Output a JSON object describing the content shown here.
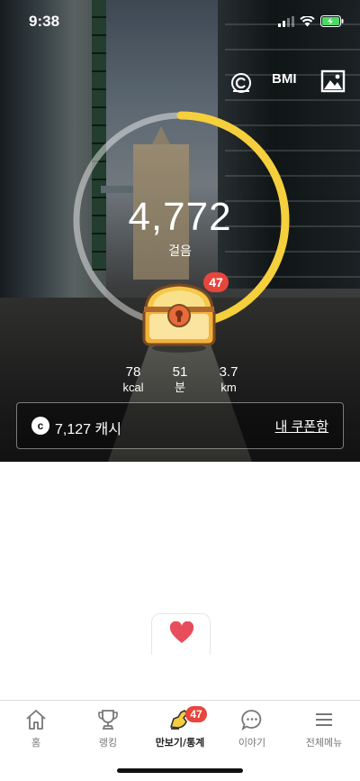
{
  "status_bar": {
    "time": "9:38",
    "battery_color": "#4cd964"
  },
  "top_actions": {
    "coin_icon": "coin-c-icon",
    "bmi_label": "BMI",
    "image_icon": "image-icon"
  },
  "pedometer": {
    "steps": "4,772",
    "steps_unit": "걸음",
    "goal_progress": 0.5,
    "ring_color": "#f5cf3c",
    "chest_badge": "47",
    "stats": [
      {
        "value": "78",
        "unit": "kcal"
      },
      {
        "value": "51",
        "unit": "분"
      },
      {
        "value": "3.7",
        "unit": "km"
      }
    ]
  },
  "cash": {
    "icon_letter": "c",
    "amount": "7,127 캐시",
    "coupon_link": "내 쿠폰함"
  },
  "heart": {
    "icon": "heart-icon",
    "color": "#e84d5b"
  },
  "tab_bar": {
    "tabs": [
      {
        "label": "홈",
        "icon": "home-icon"
      },
      {
        "label": "랭킹",
        "icon": "trophy-icon"
      },
      {
        "label": "만보기/통계",
        "icon": "shoe-icon",
        "badge": "47",
        "active": true
      },
      {
        "label": "이야기",
        "icon": "chat-bubble-icon"
      },
      {
        "label": "전체메뉴",
        "icon": "hamburger-menu-icon"
      }
    ]
  }
}
